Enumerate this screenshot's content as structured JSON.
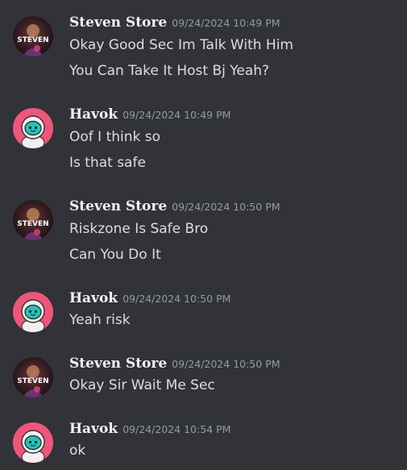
{
  "messages": [
    {
      "author": "Steven Store",
      "avatar_icon": "steven-store-avatar-icon",
      "avatar_text": "STEVEN",
      "timestamp": "09/24/2024 10:49 PM",
      "lines": [
        "Okay Good Sec Im Talk With Him",
        "You Can Take It Host Bj Yeah?"
      ]
    },
    {
      "author": "Havok",
      "avatar_icon": "havok-astronaut-avatar-icon",
      "timestamp": "09/24/2024 10:49 PM",
      "lines": [
        "Oof I think so",
        "Is that safe"
      ]
    },
    {
      "author": "Steven Store",
      "avatar_icon": "steven-store-avatar-icon",
      "avatar_text": "STEVEN",
      "timestamp": "09/24/2024 10:50 PM",
      "lines": [
        "Riskzone Is Safe Bro",
        "Can You Do It"
      ]
    },
    {
      "author": "Havok",
      "avatar_icon": "havok-astronaut-avatar-icon",
      "timestamp": "09/24/2024 10:50 PM",
      "lines": [
        "Yeah risk"
      ]
    },
    {
      "author": "Steven Store",
      "avatar_icon": "steven-store-avatar-icon",
      "avatar_text": "STEVEN",
      "timestamp": "09/24/2024 10:50 PM",
      "lines": [
        "Okay Sir Wait Me Sec"
      ]
    },
    {
      "author": "Havok",
      "avatar_icon": "havok-astronaut-avatar-icon",
      "timestamp": "09/24/2024 10:54 PM",
      "lines": [
        "ok"
      ]
    }
  ],
  "colors": {
    "background": "#313338",
    "username": "#f2f3f5",
    "message_text": "#dbdee1",
    "timestamp": "#949ba4",
    "havok_avatar_bg": "#f0557a",
    "havok_visor": "#23c4b8"
  }
}
